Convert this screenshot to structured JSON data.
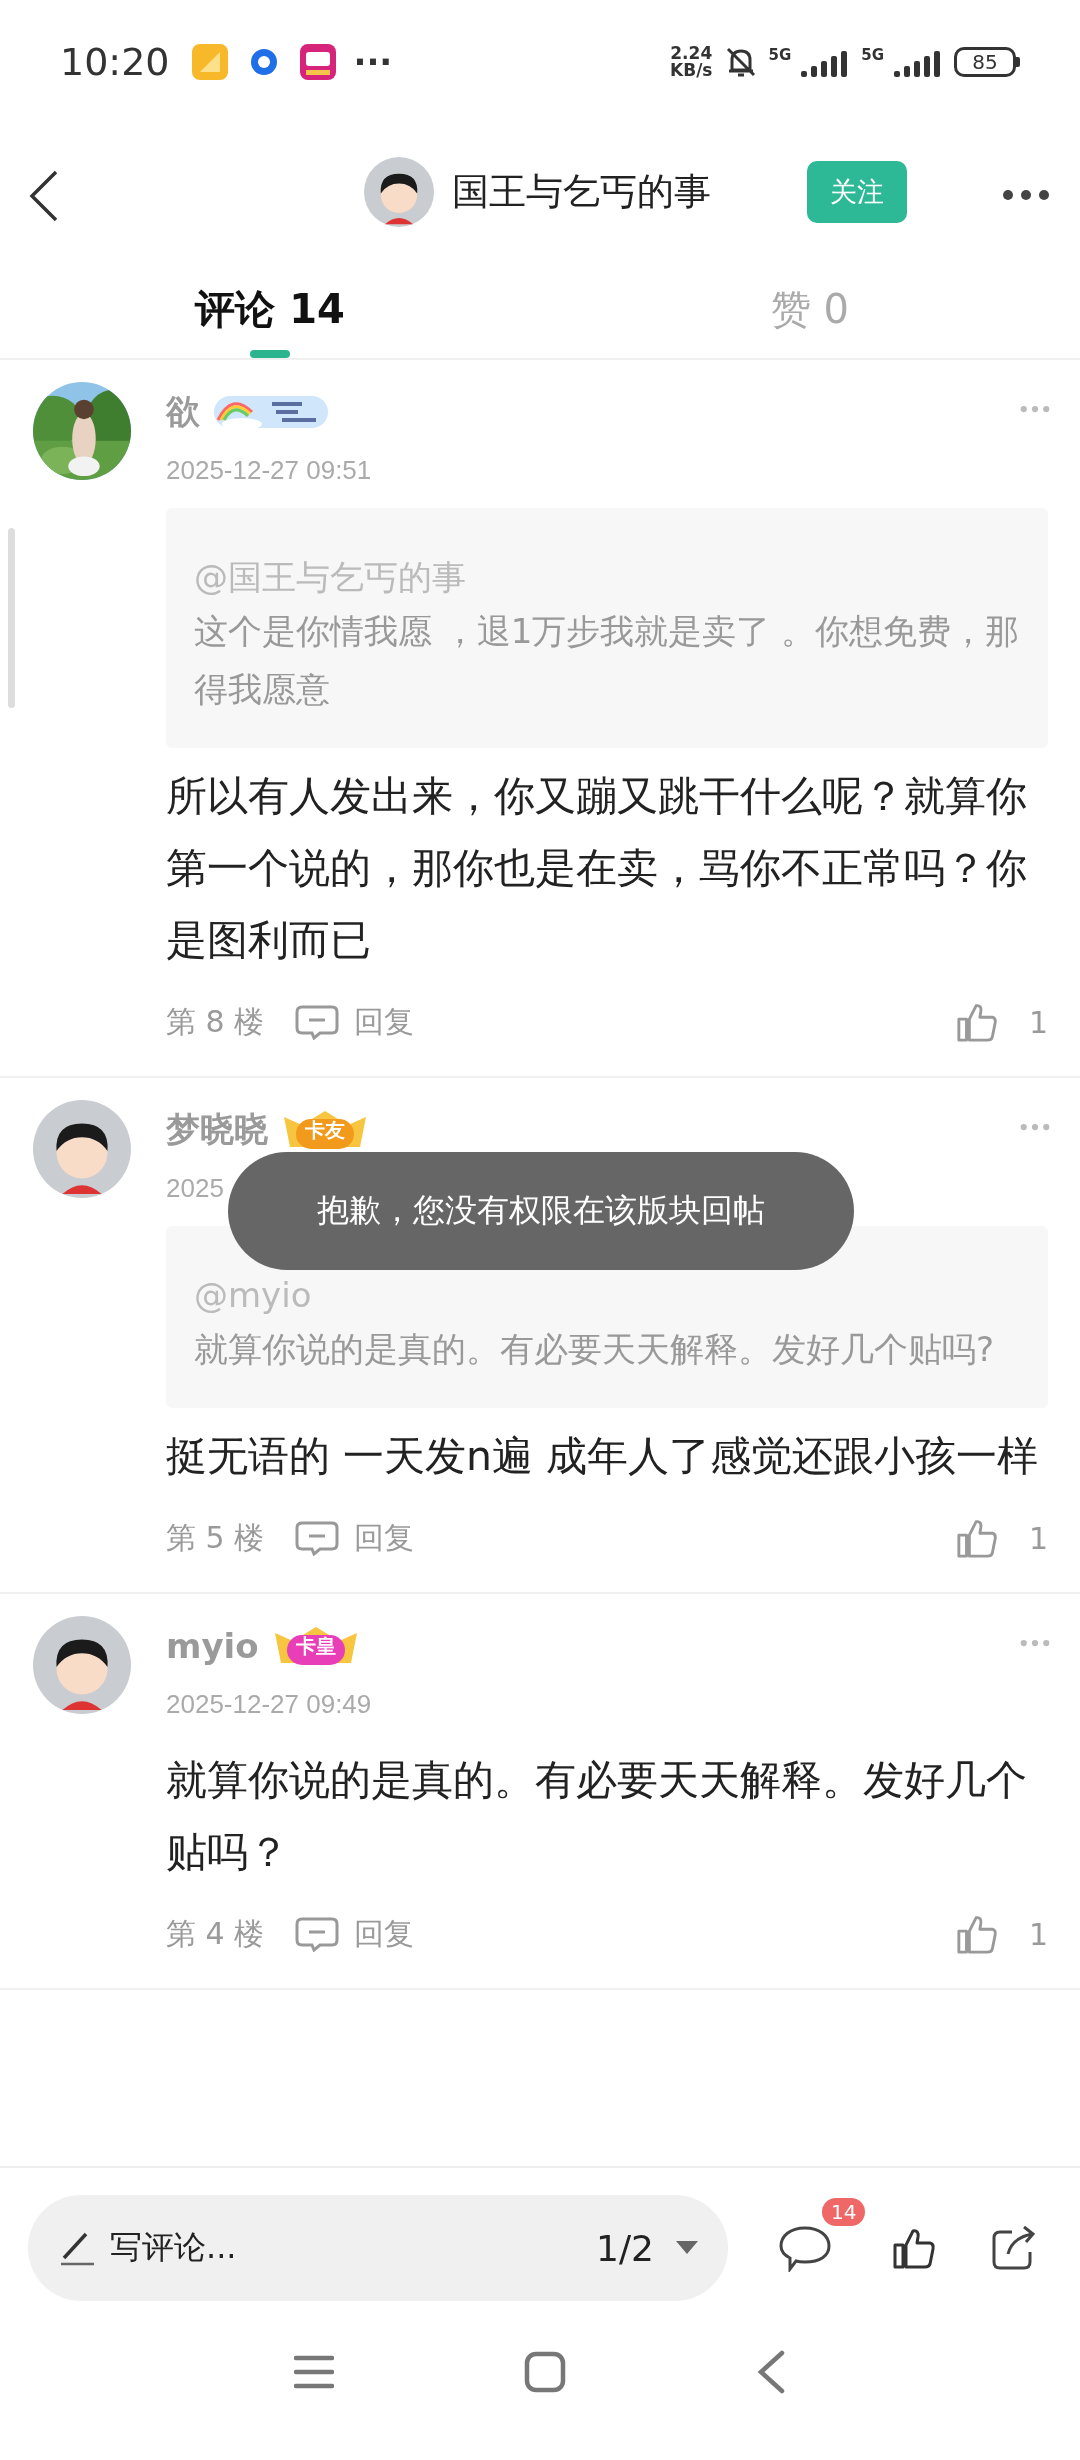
{
  "status_bar": {
    "time": "10:20",
    "more": "···",
    "speed_value": "2.24",
    "speed_unit": "KB/s",
    "network_1": "5G",
    "network_2": "5G",
    "battery": "85"
  },
  "header": {
    "title": "国王与乞丐的事",
    "follow_button": "关注"
  },
  "tabs": [
    {
      "label": "评论 14",
      "selected": true
    },
    {
      "label": "赞 0",
      "selected": false
    }
  ],
  "comments": [
    {
      "name": "欲",
      "date": "2025-12-27 09:51",
      "quote": {
        "mention": "@国王与乞丐的事",
        "text": "这个是你情我愿 ，退1万步我就是卖了 。你想免费，那得我愿意"
      },
      "text": "所以有人发出来，你又蹦又跳干什么呢？就算你第一个说的，那你也是在卖，骂你不正常吗？你是图利而已",
      "floor": "第 8 楼",
      "reply": "回复",
      "likes": "1"
    },
    {
      "avatar": {
        "kind": "cartoon"
      },
      "name": "梦晓晓",
      "badge": {
        "kind": "label",
        "label": "卡友",
        "color": "#f29a1c"
      },
      "date": "2025",
      "quote": {
        "mention": "@myio",
        "text": "就算你说的是真的。有必要天天解释。发好几个贴吗?"
      },
      "text": "挺无语的 一天发n遍 成年人了感觉还跟小孩一样",
      "floor": "第 5 楼",
      "reply": "回复",
      "likes": "1"
    },
    {
      "avatar": {
        "kind": "cartoon"
      },
      "name": "myio",
      "badge": {
        "kind": "label",
        "label": "卡皇",
        "color": "#e83fb8"
      },
      "date": "2025-12-27 09:49",
      "text": "就算你说的是真的。有必要天天解释。发好几个贴吗？",
      "floor": "第 4 楼",
      "reply": "回复",
      "likes": "1"
    }
  ],
  "toast": "抱歉，您没有权限在该版块回帖",
  "bottom_bar": {
    "placeholder": "写评论...",
    "page": "1/2",
    "comment_count": "14"
  }
}
